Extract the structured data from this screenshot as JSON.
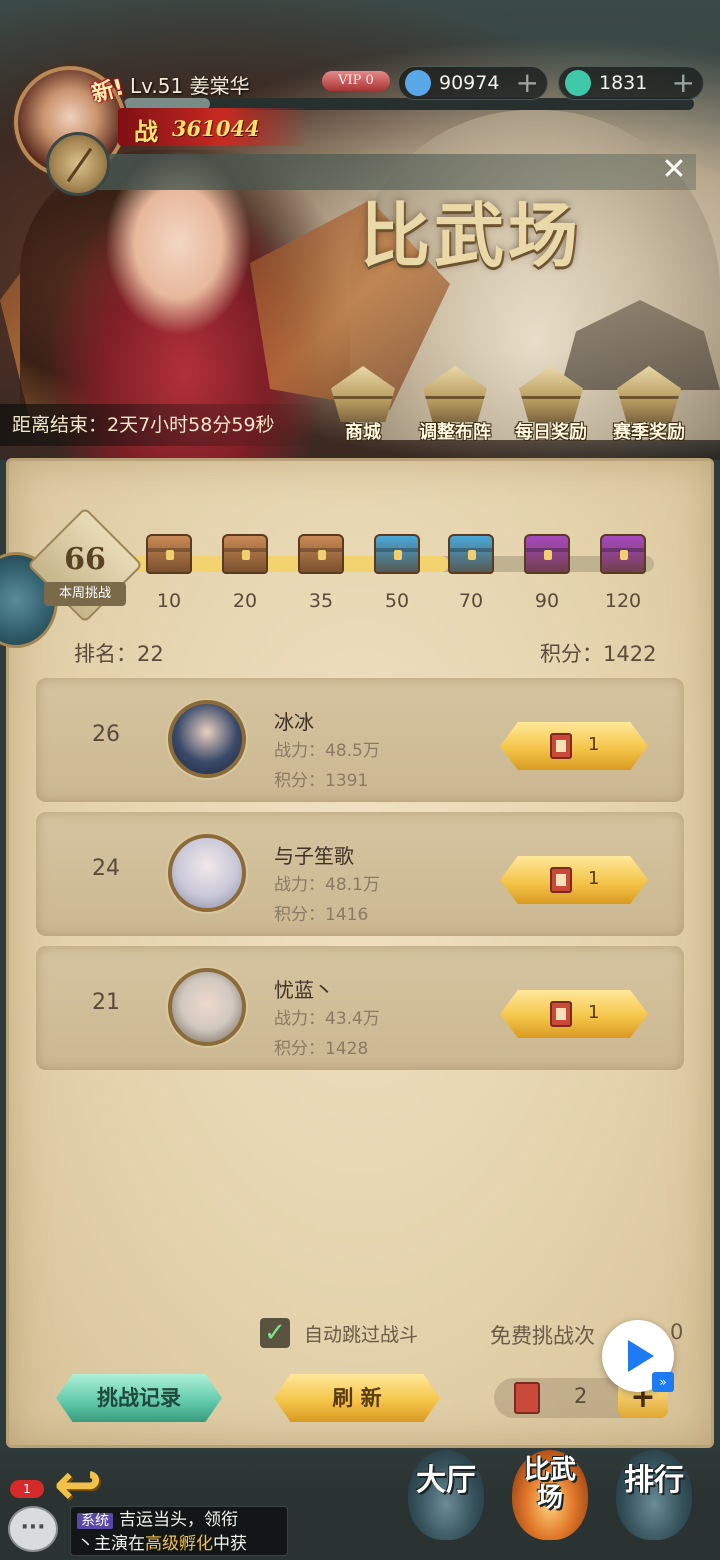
{
  "player": {
    "new_tag": "新!",
    "level_name": "Lv.51 姜棠华",
    "power_prefix": "战",
    "power": "361044",
    "vip": "VIP 0"
  },
  "currencies": [
    {
      "value": "90974",
      "icon": "diamond-icon",
      "color": "#5aa8e8",
      "plus": "+"
    },
    {
      "value": "1831",
      "icon": "jade-coin-icon",
      "color": "#3fc9a8",
      "plus": "+"
    }
  ],
  "close_symbol": "✕",
  "hero": {
    "title": "比武场",
    "countdown": "距离结束：2天7小时58分59秒",
    "buttons": [
      {
        "label": "商城",
        "icon": "shop-icon"
      },
      {
        "label": "调整布阵",
        "icon": "formation-icon"
      },
      {
        "label": "每日奖励",
        "icon": "gift-icon"
      },
      {
        "label": "赛季奖励",
        "icon": "gift-icon"
      }
    ]
  },
  "weekly": {
    "count": "66",
    "label": "本周挑战",
    "progress": 0.62,
    "milestones": [
      {
        "value": "10",
        "chest": "wood",
        "color": "#c98a55"
      },
      {
        "value": "20",
        "chest": "wood",
        "color": "#c98a55"
      },
      {
        "value": "35",
        "chest": "wood",
        "color": "#c98a55"
      },
      {
        "value": "50",
        "chest": "blue-open",
        "color": "#4aa8d8"
      },
      {
        "value": "70",
        "chest": "blue",
        "color": "#4aa8d8"
      },
      {
        "value": "90",
        "chest": "purple",
        "color": "#a84ac0"
      },
      {
        "value": "120",
        "chest": "purple",
        "color": "#a84ac0"
      }
    ]
  },
  "rank_info": {
    "rank_text": "排名：22",
    "score_text": "积分：1422"
  },
  "opponents": [
    {
      "rank": "26",
      "name": "冰冰",
      "power": "战力：48.5万",
      "score": "积分：1391",
      "cost": "1",
      "avatar_color": "#3a4a6a"
    },
    {
      "rank": "24",
      "name": "与子笙歌",
      "power": "战力：48.1万",
      "score": "积分：1416",
      "cost": "1",
      "avatar_color": "#c8c8d8"
    },
    {
      "rank": "21",
      "name": "忧蓝丶",
      "power": "战力：43.4万",
      "score": "积分：1428",
      "cost": "1",
      "avatar_color": "#d0c8c0"
    }
  ],
  "controls": {
    "auto_skip": "自动跳过战斗",
    "auto_check": "✓",
    "free_label": "免费挑战次",
    "free_value": "0",
    "record_btn": "挑战记录",
    "refresh_btn": "刷 新",
    "ticket_count": "2",
    "add": "+"
  },
  "nav": {
    "back_symbol": "↩",
    "notif_count": "1",
    "chat_icon_text": "···",
    "chat_sys": "系统",
    "chat_line1": "吉运当头，领衔",
    "chat_line2_a": "丶主演在",
    "chat_line2_b": "高级孵化",
    "chat_line2_c": "中获",
    "tabs": [
      {
        "label": "大厅",
        "active": false
      },
      {
        "label": "比武场",
        "active": true
      },
      {
        "label": "排行",
        "active": false
      }
    ]
  }
}
